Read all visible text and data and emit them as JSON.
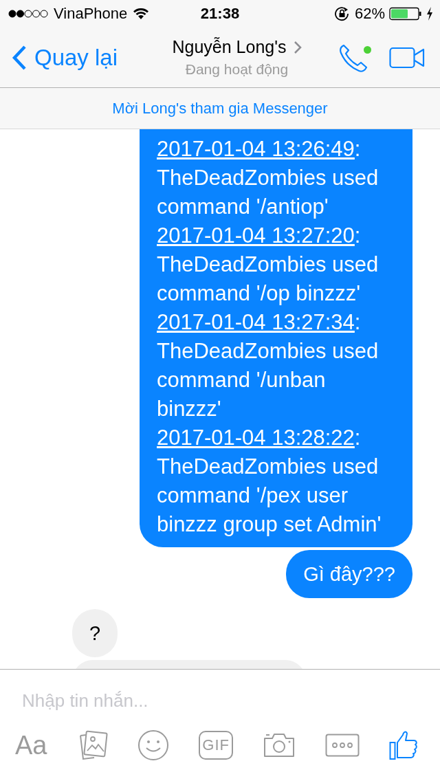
{
  "status_bar": {
    "carrier": "VinaPhone",
    "time": "21:38",
    "battery": "62%"
  },
  "header": {
    "back": "Quay lại",
    "name": "Nguyễn Long's",
    "status": "Đang hoạt động",
    "online": true
  },
  "invite": "Mời Long's tham gia Messenger",
  "messages": [
    {
      "outgoing": true,
      "kind": "log",
      "entries": [
        {
          "timestamp": "2017-01-04 13:26:49",
          "text": ": TheDeadZombies used command '/antiop'"
        },
        {
          "timestamp": "2017-01-04 13:27:20",
          "text": ": TheDeadZombies used command '/op binzzz'"
        },
        {
          "timestamp": "2017-01-04 13:27:34",
          "text": ": TheDeadZombies used command '/unban binzzz'"
        },
        {
          "timestamp": "2017-01-04 13:28:22",
          "text": ": TheDeadZombies used command '/pex user binzzz group set Admin'"
        }
      ]
    },
    {
      "outgoing": true,
      "kind": "text",
      "text": "Gì đây???"
    },
    {
      "outgoing": false,
      "kind": "text",
      "text": "?"
    },
    {
      "outgoing": false,
      "kind": "cut"
    }
  ],
  "composer": {
    "placeholder": "Nhập tin nhắn..."
  },
  "toolbar": [
    {
      "kind": "format",
      "label": "Aa"
    },
    {
      "kind": "photo"
    },
    {
      "kind": "emoji"
    },
    {
      "kind": "gif",
      "label": "GIF"
    },
    {
      "kind": "camera"
    },
    {
      "kind": "more"
    },
    {
      "kind": "like"
    }
  ]
}
